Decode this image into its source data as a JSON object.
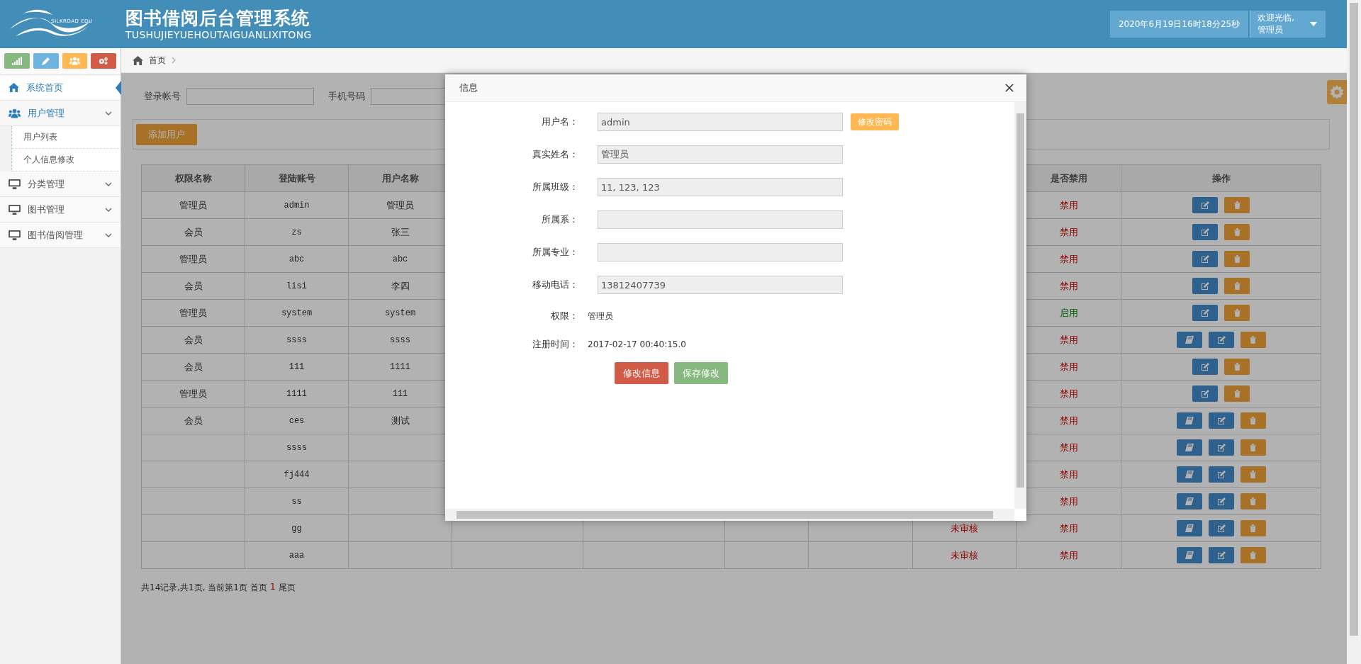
{
  "header": {
    "logo_text": "SILKROAD EDU",
    "title": "图书借阅后台管理系统",
    "subtitle": "TUSHUJIEYUEHOUTAIGUANLIXITONG",
    "datetime": "2020年6月19日16时18分25秒",
    "welcome": "欢迎光临,",
    "user": "管理员"
  },
  "sidebar": {
    "shortcuts": [
      {
        "kind": "bars",
        "color": "#87b87f"
      },
      {
        "kind": "pencil",
        "color": "#6fb3e0"
      },
      {
        "kind": "users",
        "color": "#ffb752"
      },
      {
        "kind": "cogs",
        "color": "#d15b47"
      }
    ],
    "items": [
      {
        "label": "系统首页",
        "kind": "home",
        "selected": true,
        "expanded": false
      },
      {
        "label": "用户管理",
        "kind": "users",
        "selected": false,
        "expanded": true,
        "children": [
          {
            "label": "用户列表"
          },
          {
            "label": "个人信息修改"
          }
        ]
      },
      {
        "label": "分类管理",
        "kind": "monitor",
        "selected": false,
        "expanded": false
      },
      {
        "label": "图书管理",
        "kind": "monitor",
        "selected": false,
        "expanded": false
      },
      {
        "label": "图书借阅管理",
        "kind": "monitor",
        "selected": false,
        "expanded": false
      }
    ]
  },
  "breadcrumb": [
    "首页"
  ],
  "search": {
    "fields": [
      {
        "label": "登录帐号"
      },
      {
        "label": "手机号码"
      }
    ]
  },
  "toolbar": {
    "add_button": "添加用户"
  },
  "table": {
    "columns": [
      "权限名称",
      "登陆账号",
      "用户名称",
      "是否禁用",
      "操作"
    ],
    "rows": [
      {
        "role": "管理员",
        "account": "admin",
        "username": "管理员",
        "status": "禁用",
        "enabled": false,
        "actions": [
          {
            "kind": "edit"
          },
          {
            "kind": "delete"
          }
        ]
      },
      {
        "role": "会员",
        "account": "zs",
        "username": "张三",
        "status": "禁用",
        "enabled": false,
        "actions": [
          {
            "kind": "edit"
          },
          {
            "kind": "delete"
          }
        ]
      },
      {
        "role": "管理员",
        "account": "abc",
        "username": "abc",
        "status": "禁用",
        "enabled": false,
        "actions": [
          {
            "kind": "edit"
          },
          {
            "kind": "delete"
          }
        ]
      },
      {
        "role": "会员",
        "account": "lisi",
        "username": "李四",
        "status": "禁用",
        "enabled": false,
        "actions": [
          {
            "kind": "edit"
          },
          {
            "kind": "delete"
          }
        ]
      },
      {
        "role": "管理员",
        "account": "system",
        "username": "system",
        "status": "启用",
        "enabled": true,
        "actions": [
          {
            "kind": "edit"
          },
          {
            "kind": "delete"
          }
        ]
      },
      {
        "role": "会员",
        "account": "ssss",
        "username": "ssss",
        "status": "禁用",
        "enabled": false,
        "actions": [
          {
            "kind": "book"
          },
          {
            "kind": "edit"
          },
          {
            "kind": "delete"
          }
        ]
      },
      {
        "role": "会员",
        "account": "111",
        "username": "1111",
        "status": "禁用",
        "enabled": false,
        "actions": [
          {
            "kind": "edit"
          },
          {
            "kind": "delete"
          }
        ]
      },
      {
        "role": "管理员",
        "account": "1111",
        "username": "111",
        "status": "禁用",
        "enabled": false,
        "actions": [
          {
            "kind": "edit"
          },
          {
            "kind": "delete"
          }
        ]
      },
      {
        "role": "会员",
        "account": "ces",
        "username": "测试",
        "status": "禁用",
        "enabled": false,
        "actions": [
          {
            "kind": "book"
          },
          {
            "kind": "edit"
          },
          {
            "kind": "delete"
          }
        ]
      },
      {
        "account": "ssss",
        "status": "禁用",
        "enabled": false,
        "actions": [
          {
            "kind": "book"
          },
          {
            "kind": "edit"
          },
          {
            "kind": "delete"
          }
        ]
      },
      {
        "account": "fj444",
        "status": "禁用",
        "enabled": false,
        "actions": [
          {
            "kind": "book"
          },
          {
            "kind": "edit"
          },
          {
            "kind": "delete"
          }
        ]
      },
      {
        "account": "ss",
        "status": "禁用",
        "enabled": false,
        "actions": [
          {
            "kind": "book"
          },
          {
            "kind": "edit"
          },
          {
            "kind": "delete"
          }
        ]
      },
      {
        "account": "gg",
        "column_8": "未审核",
        "status": "禁用",
        "enabled": false,
        "actions": [
          {
            "kind": "book"
          },
          {
            "kind": "edit"
          },
          {
            "kind": "delete"
          }
        ]
      },
      {
        "account": "aaa",
        "column_8": "未审核",
        "status": "禁用",
        "enabled": false,
        "actions": [
          {
            "kind": "book"
          },
          {
            "kind": "edit"
          },
          {
            "kind": "delete"
          }
        ]
      }
    ]
  },
  "pagination": {
    "summary": "共14记录,共1页, 当前第1页",
    "first": "首页",
    "pages": [
      {
        "label": "1",
        "selected": true
      }
    ],
    "last": "尾页"
  },
  "dialog": {
    "title": "信息",
    "fields": [
      {
        "kind": "input",
        "label": "用户名：",
        "value": "admin",
        "button": "修改密码"
      },
      {
        "kind": "input",
        "label": "真实姓名：",
        "value": "管理员"
      },
      {
        "kind": "input",
        "label": "所属班级：",
        "value": "11, 123, 123"
      },
      {
        "kind": "input",
        "label": "所属系："
      },
      {
        "kind": "input",
        "label": "所属专业："
      },
      {
        "kind": "input",
        "label": "移动电话：",
        "value": "13812407739"
      },
      {
        "kind": "text",
        "label": "权限：",
        "value": "管理员"
      },
      {
        "kind": "text",
        "label": "注册时间：",
        "value": "2017-02-17 00:40:15.0"
      }
    ],
    "buttons": [
      {
        "label": "修改信息",
        "kind": "danger"
      },
      {
        "label": "保存修改",
        "kind": "success"
      }
    ]
  }
}
